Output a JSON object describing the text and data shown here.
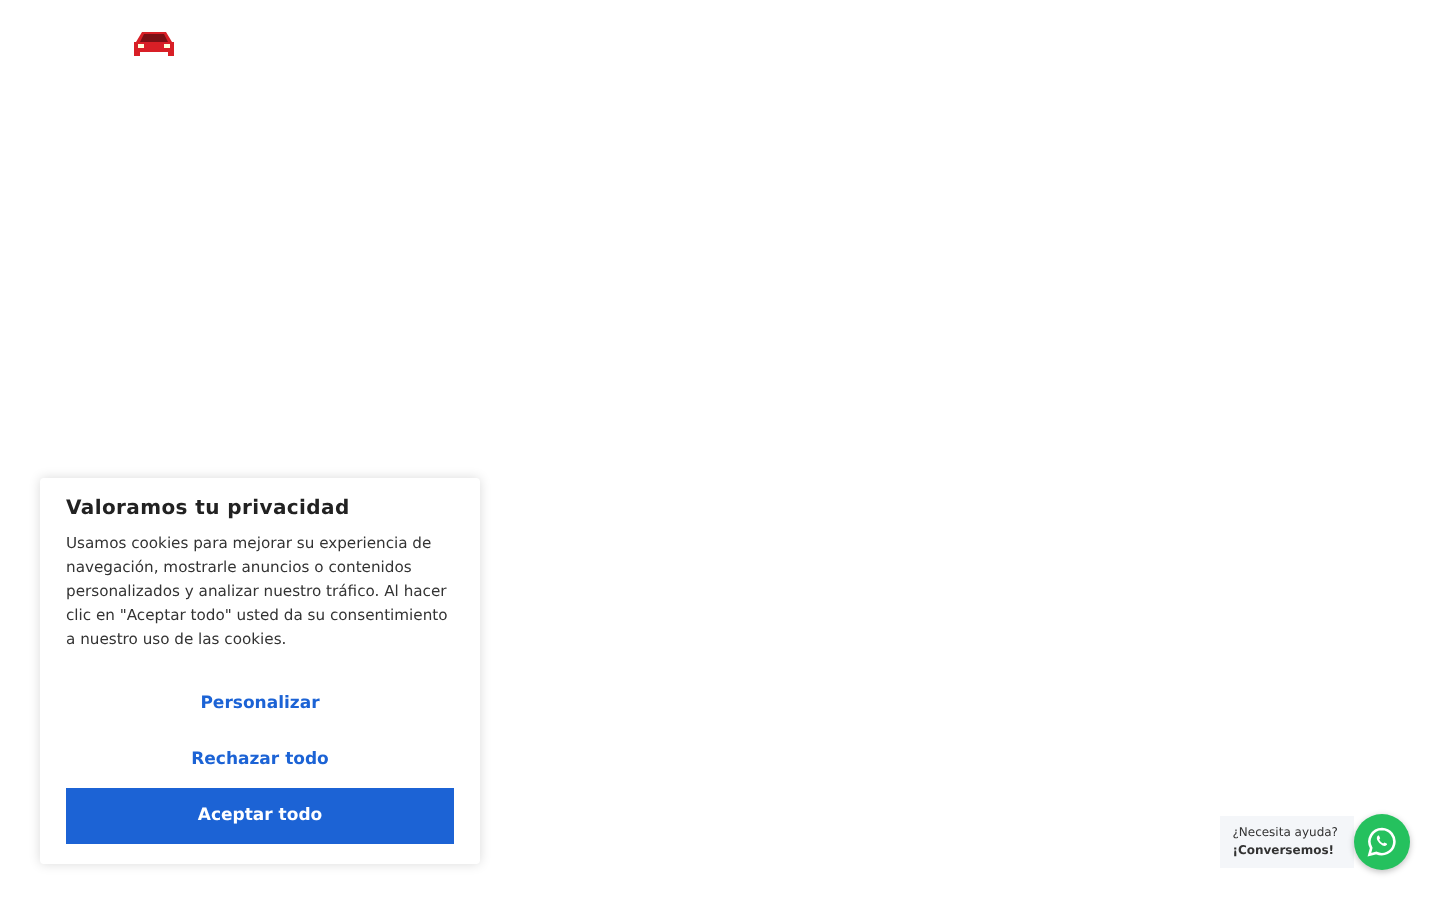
{
  "consent": {
    "title": "Valoramos tu privacidad",
    "text": "Usamos cookies para mejorar su experiencia de navegación, mostrarle anuncios o contenidos personalizados y analizar nuestro tráfico. Al hacer clic en \"Aceptar todo\" usted da su consentimiento a nuestro uso de las cookies.",
    "buttons": [
      {
        "label": "Personalizar",
        "kind": "link"
      },
      {
        "label": "Rechazar todo",
        "kind": "link"
      },
      {
        "label": "Aceptar todo",
        "kind": "primary"
      }
    ]
  },
  "chat": {
    "question": "¿Necesita ayuda?",
    "action": "¡Conversemos!"
  }
}
